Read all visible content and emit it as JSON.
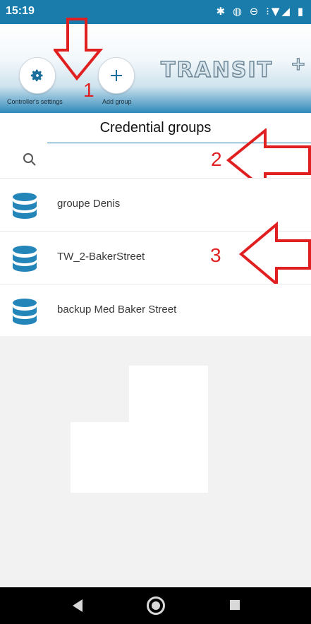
{
  "status_bar": {
    "time": "15:19",
    "icons": "✱ ◍ ⊖ ⁝▼◢ ▮"
  },
  "header": {
    "settings_label": "Controller's settings",
    "add_label": "Add group",
    "logo_text": "TRANSIT",
    "logo_plus": "+"
  },
  "title": "Credential groups",
  "search": {
    "placeholder": "",
    "value": ""
  },
  "groups": [
    {
      "label": "groupe Denis"
    },
    {
      "label": "TW_2-BakerStreet"
    },
    {
      "label": "backup Med Baker Street"
    }
  ],
  "annotations": {
    "a1": "1",
    "a2": "2",
    "a3": "3"
  },
  "colors": {
    "accent": "#1a7cab",
    "annotation": "#e02020"
  },
  "icons": [
    "gear-icon",
    "plus-icon",
    "search-icon",
    "database-icon",
    "back-icon",
    "home-icon",
    "recents-icon"
  ]
}
